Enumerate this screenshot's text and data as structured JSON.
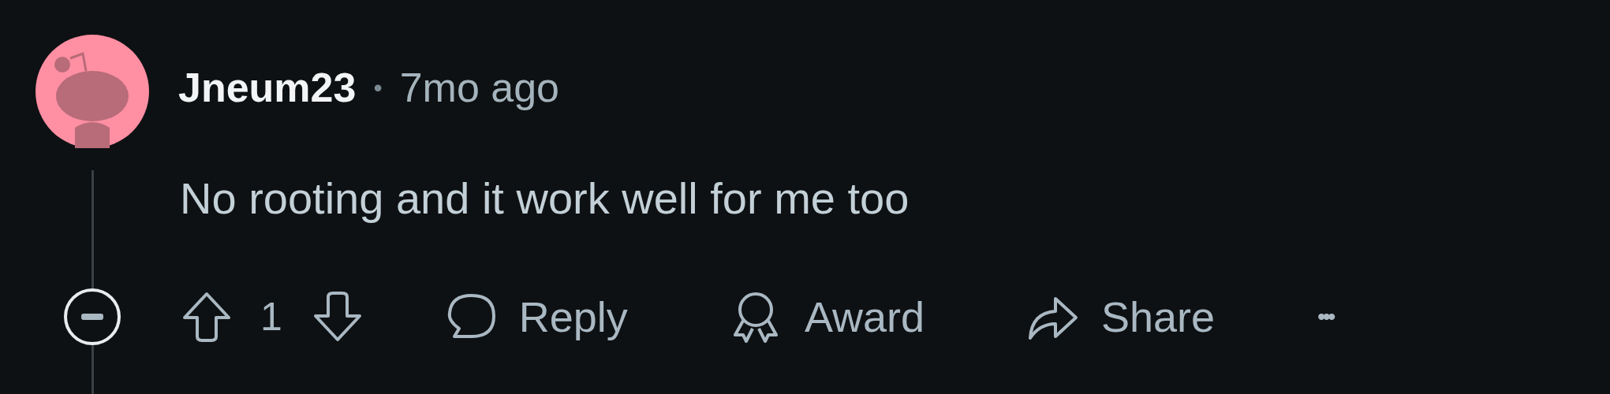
{
  "comment": {
    "author": "Jneum23",
    "separator": "•",
    "time": "7mo ago",
    "body": "No rooting and it work well for me too",
    "score": "1",
    "actions": [
      {
        "kind": "reply",
        "label": "Reply"
      },
      {
        "kind": "award",
        "label": "Award"
      },
      {
        "kind": "share",
        "label": "Share"
      },
      {
        "kind": "more",
        "label": "•••"
      }
    ]
  }
}
